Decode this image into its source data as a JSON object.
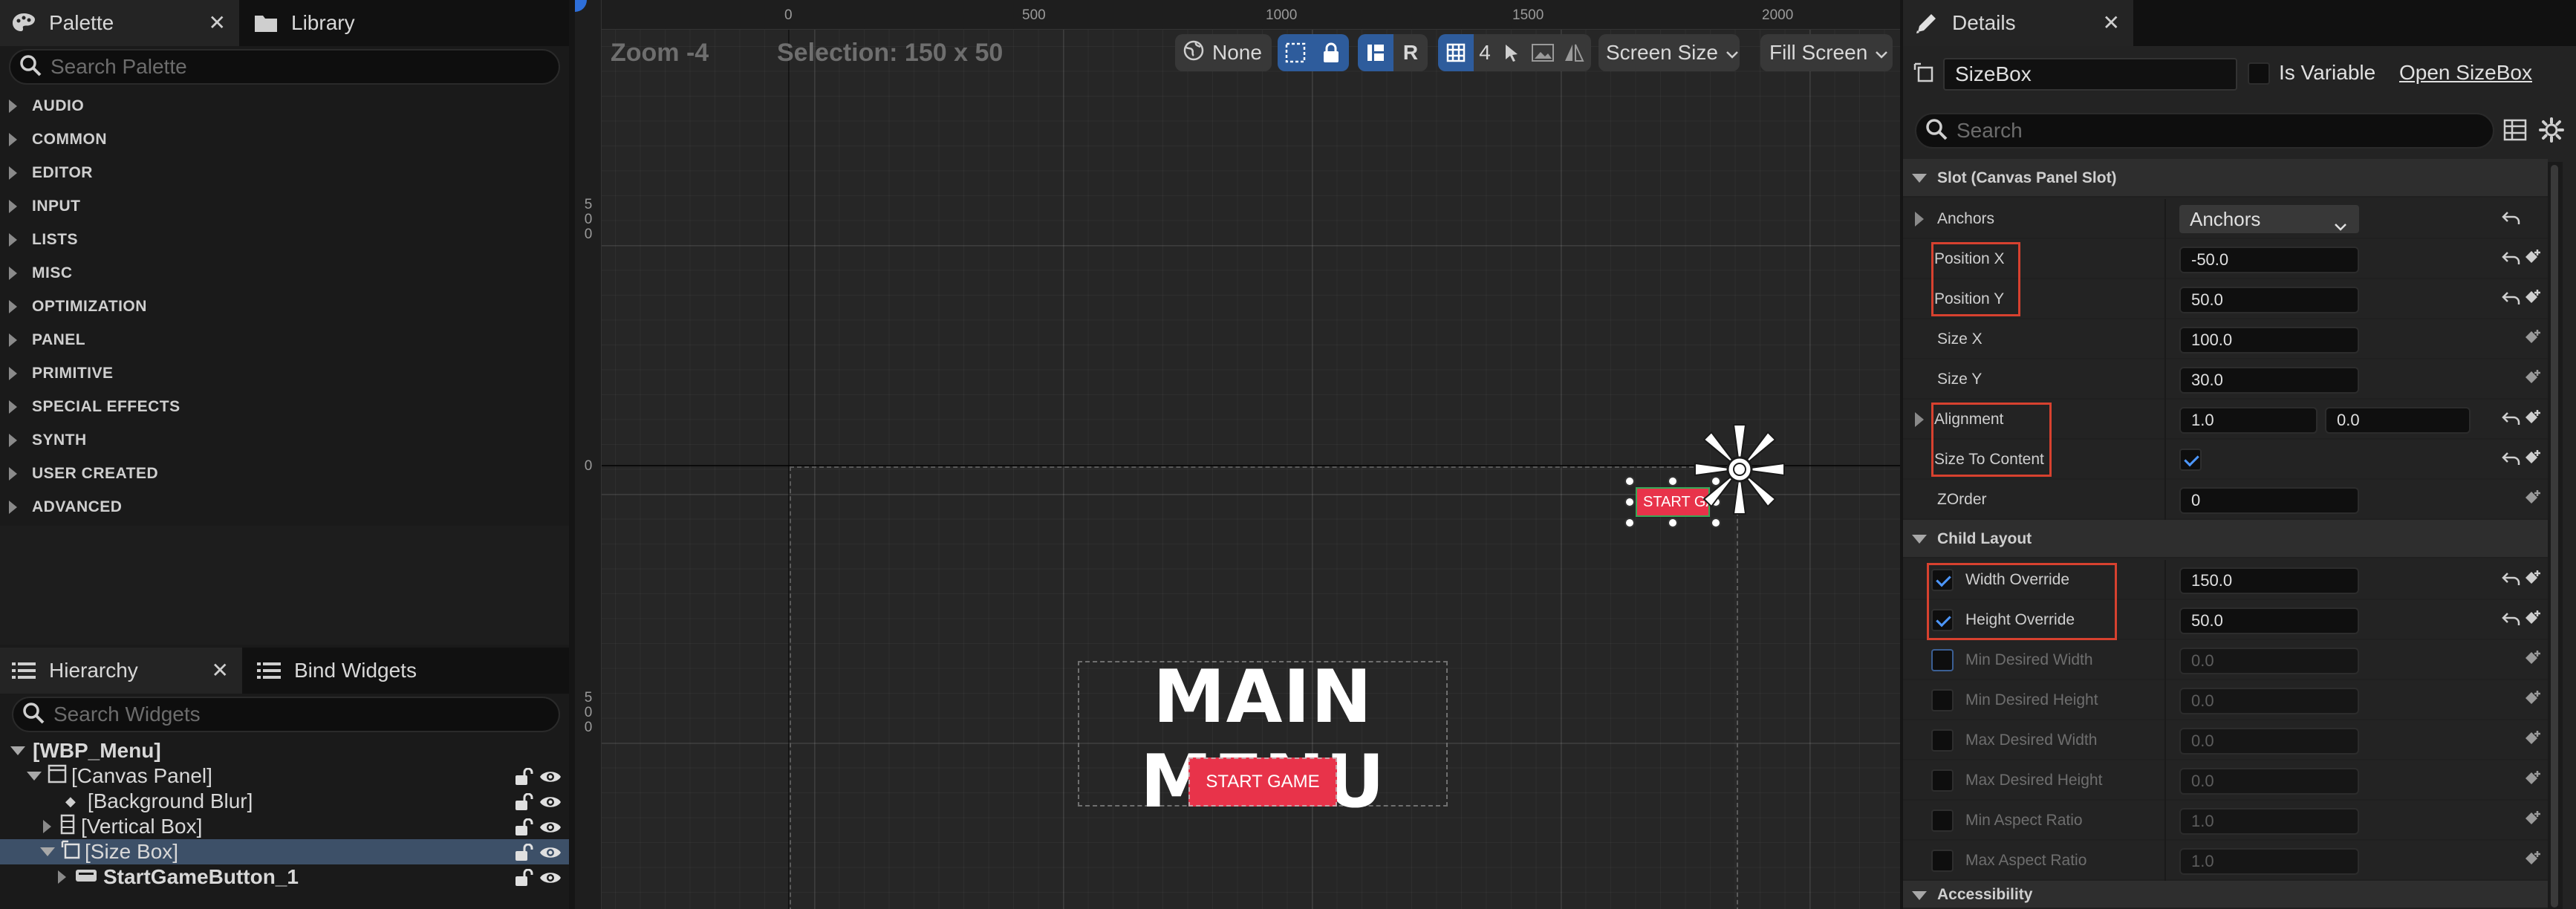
{
  "palette": {
    "tab_label": "Palette",
    "library_tab_label": "Library",
    "search_placeholder": "Search Palette",
    "categories": [
      "AUDIO",
      "COMMON",
      "EDITOR",
      "INPUT",
      "LISTS",
      "MISC",
      "OPTIMIZATION",
      "PANEL",
      "PRIMITIVE",
      "SPECIAL EFFECTS",
      "SYNTH",
      "USER CREATED",
      "ADVANCED"
    ]
  },
  "hierarchy": {
    "tab_label": "Hierarchy",
    "bind_tab_label": "Bind Widgets",
    "search_placeholder": "Search Widgets",
    "items": [
      {
        "label": "[WBP_Menu]"
      },
      {
        "label": "[Canvas Panel]"
      },
      {
        "label": "[Background Blur]"
      },
      {
        "label": "[Vertical Box]"
      },
      {
        "label": "[Size Box]"
      },
      {
        "label": "StartGameButton_1"
      }
    ]
  },
  "viewport": {
    "zoom": "Zoom -4",
    "selection": "Selection: 150 x 50",
    "ruler_top": [
      "0",
      "500",
      "1000",
      "1500",
      "2000"
    ],
    "ruler_left": [
      "500",
      "0",
      "500"
    ],
    "toolbar": {
      "none_label": "None",
      "r_label": "R",
      "grid_count": "4",
      "screen_size_label": "Screen Size",
      "fill_screen_label": "Fill Screen"
    },
    "menu_title": "MAIN MENU",
    "start_button_label": "START GAME",
    "small_button_label": "START GAME",
    "accent_red": "#e8334a"
  },
  "details": {
    "tab_label": "Details",
    "widget_name": "SizeBox",
    "is_variable_label": "Is Variable",
    "open_label": "Open SizeBox",
    "search_placeholder": "Search",
    "slot_section": "Slot (Canvas Panel Slot)",
    "anchors_label": "Anchors",
    "anchors_value": "Anchors",
    "position_x_label": "Position X",
    "position_x": "-50.0",
    "position_y_label": "Position Y",
    "position_y": "50.0",
    "size_x_label": "Size X",
    "size_x": "100.0",
    "size_y_label": "Size Y",
    "size_y": "30.0",
    "alignment_label": "Alignment",
    "alignment_x": "1.0",
    "alignment_y": "0.0",
    "size_to_content_label": "Size To Content",
    "zorder_label": "ZOrder",
    "zorder": "0",
    "child_section": "Child Layout",
    "width_override_label": "Width Override",
    "width_override": "150.0",
    "height_override_label": "Height Override",
    "height_override": "50.0",
    "min_desired_width_label": "Min Desired Width",
    "min_desired_width": "0.0",
    "min_desired_height_label": "Min Desired Height",
    "min_desired_height": "0.0",
    "max_desired_width_label": "Max Desired Width",
    "max_desired_width": "0.0",
    "max_desired_height_label": "Max Desired Height",
    "max_desired_height": "0.0",
    "min_aspect_label": "Min Aspect Ratio",
    "min_aspect": "1.0",
    "max_aspect_label": "Max Aspect Ratio",
    "max_aspect": "1.0",
    "accessibility_section": "Accessibility",
    "highlight_color": "#d7412f"
  }
}
